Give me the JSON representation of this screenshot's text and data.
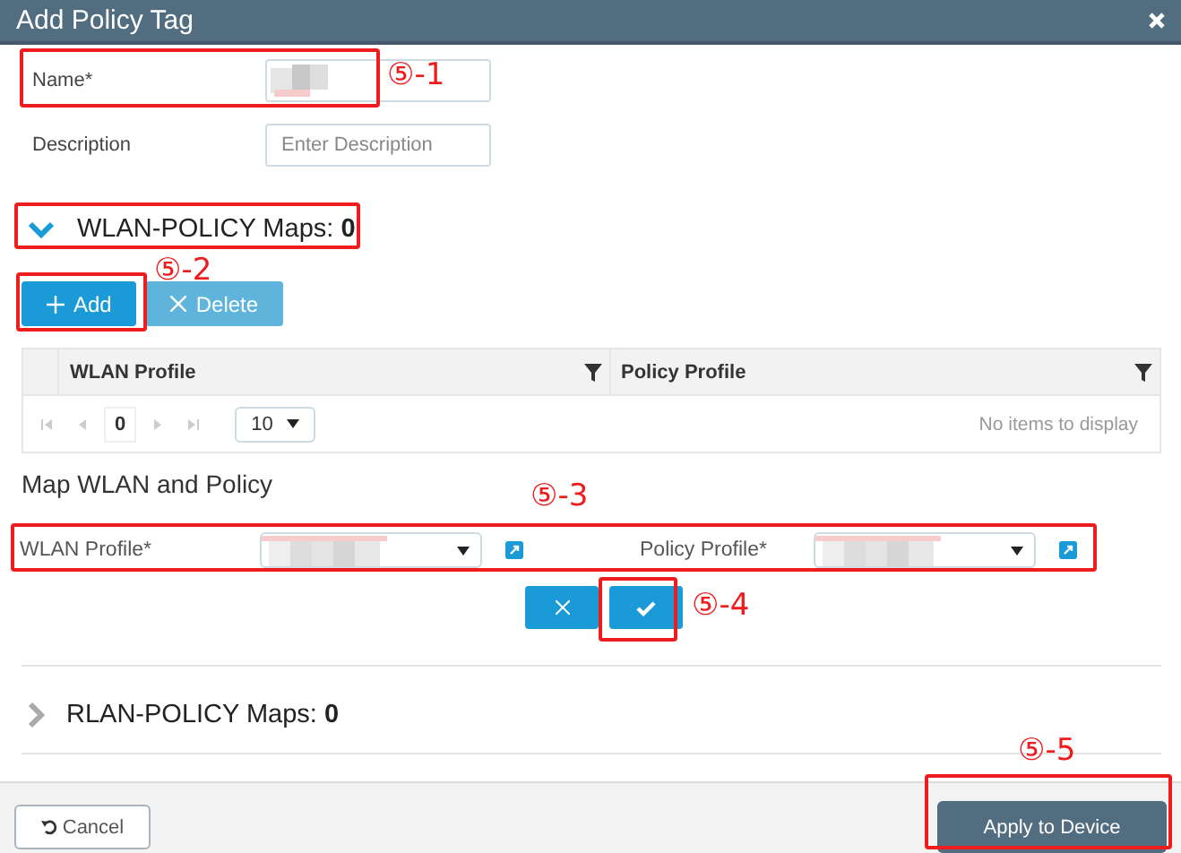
{
  "window": {
    "title": "Add Policy Tag"
  },
  "form": {
    "fields": [
      {
        "label": "Name*",
        "kind": "redacted"
      },
      {
        "label": "Description",
        "kind": "text",
        "placeholder": "Enter Description"
      }
    ]
  },
  "wlan_policy_maps": {
    "title": "WLAN-POLICY Maps: **0**",
    "expanded": true,
    "buttons": [
      {
        "label": "Add",
        "kind": "add",
        "disabled": false
      },
      {
        "label": "Delete",
        "kind": "delete",
        "disabled": true
      }
    ],
    "table": {
      "columns": [
        "WLAN Profile",
        "Policy Profile"
      ],
      "page": "0",
      "page_size": "10",
      "empty_message": "No items to display"
    },
    "map": {
      "title": "Map WLAN and Policy",
      "fields": [
        {
          "label": "WLAN Profile*"
        },
        {
          "label": "Policy Profile*"
        }
      ]
    }
  },
  "rlan_policy_maps": {
    "title": "RLAN-POLICY Maps: **0**",
    "expanded": false
  },
  "footer": {
    "cancel": "Cancel",
    "apply": "Apply to Device"
  },
  "annotations": [
    {
      "label": "⑤-1"
    },
    {
      "label": "⑤-2"
    },
    {
      "label": "⑤-3"
    },
    {
      "label": "⑤-4"
    },
    {
      "label": "⑤-5"
    }
  ]
}
